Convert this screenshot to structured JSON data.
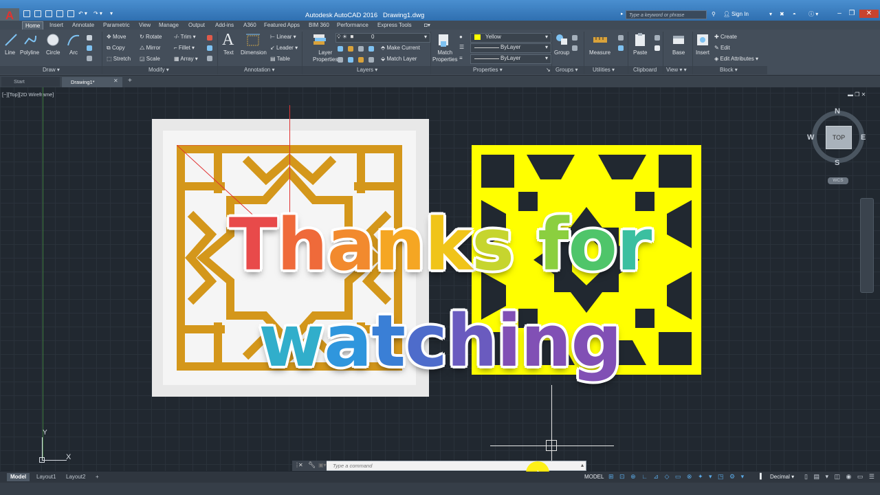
{
  "app": {
    "logo_letter": "A",
    "title": "Autodesk AutoCAD 2016",
    "document": "Drawing1.dwg",
    "search_placeholder": "Type a keyword or phrase",
    "sign_in": "Sign In"
  },
  "ribbon_tabs": [
    "Home",
    "Insert",
    "Annotate",
    "Parametric",
    "View",
    "Manage",
    "Output",
    "Add-ins",
    "A360",
    "Featured Apps",
    "BIM 360",
    "Performance",
    "Express Tools"
  ],
  "ribbon": {
    "draw": {
      "line": "Line",
      "polyline": "Polyline",
      "circle": "Circle",
      "arc": "Arc",
      "panel": "Draw"
    },
    "modify": {
      "move": "Move",
      "rotate": "Rotate",
      "trim": "Trim",
      "copy": "Copy",
      "mirror": "Mirror",
      "fillet": "Fillet",
      "stretch": "Stretch",
      "scale": "Scale",
      "array": "Array",
      "panel": "Modify"
    },
    "annotation": {
      "text": "Text",
      "dimension": "Dimension",
      "linear": "Linear",
      "leader": "Leader",
      "table": "Table",
      "panel": "Annotation"
    },
    "layers": {
      "layer_properties_1": "Layer",
      "layer_properties_2": "Properties",
      "layer_value": "0",
      "make_current": "Make Current",
      "match_layer": "Match Layer",
      "panel": "Layers"
    },
    "properties": {
      "match_1": "Match",
      "match_2": "Properties",
      "color": "Yellow",
      "linetype": "ByLayer",
      "lineweight": "ByLayer",
      "panel": "Properties"
    },
    "groups": {
      "group": "Group",
      "panel": "Groups"
    },
    "utilities": {
      "measure": "Measure",
      "panel": "Utilities"
    },
    "clipboard": {
      "paste": "Paste",
      "panel": "Clipboard"
    },
    "view": {
      "base": "Base",
      "panel": "View"
    },
    "block": {
      "insert": "Insert",
      "create": "Create",
      "edit": "Edit",
      "edit_attributes": "Edit Attributes",
      "panel": "Block"
    }
  },
  "file_tabs": {
    "start": "Start",
    "drawing": "Drawing1*"
  },
  "viewport": {
    "label": "[−][Top][2D Wireframe]",
    "viewcube": {
      "n": "N",
      "s": "S",
      "e": "E",
      "w": "W",
      "face": "TOP",
      "wcs": "WCS"
    },
    "ucs": {
      "x": "X",
      "y": "Y"
    }
  },
  "overlay_text": {
    "word1": "Thanks",
    "word2": "for",
    "word3": "watching"
  },
  "command_line": {
    "placeholder": "Type a command"
  },
  "layout_tabs": [
    "Model",
    "Layout1",
    "Layout2"
  ],
  "status": {
    "model": "MODEL",
    "units": "Decimal"
  },
  "colors": {
    "accent": "#2f6fb0",
    "pattern_gold": "#d4971b",
    "pattern_yellow": "#ffff00",
    "background": "#212830"
  }
}
